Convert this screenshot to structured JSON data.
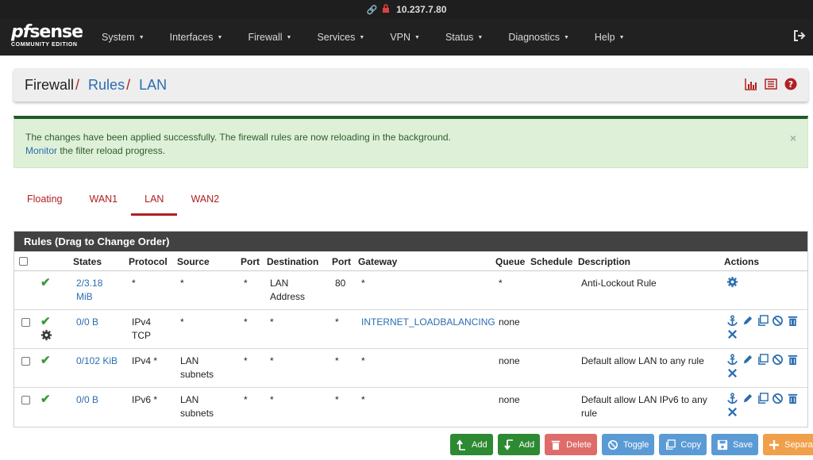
{
  "browser": {
    "url": "10.237.7.80"
  },
  "brand": {
    "name_italic": "pf",
    "name_rest": "sense",
    "edition": "COMMUNITY EDITION"
  },
  "nav": {
    "items": [
      "System",
      "Interfaces",
      "Firewall",
      "Services",
      "VPN",
      "Status",
      "Diagnostics",
      "Help"
    ]
  },
  "breadcrumb": {
    "root": "Firewall",
    "sep": "/",
    "rules": "Rules",
    "current": "LAN"
  },
  "alert": {
    "line1": "The changes have been applied successfully. The firewall rules are now reloading in the background.",
    "link": "Monitor",
    "line2_rest": " the filter reload progress.",
    "close": "×"
  },
  "tabs": [
    "Floating",
    "WAN1",
    "LAN",
    "WAN2"
  ],
  "table": {
    "title": "Rules (Drag to Change Order)",
    "headers": {
      "states": "States",
      "protocol": "Protocol",
      "source": "Source",
      "port": "Port",
      "destination": "Destination",
      "dport": "Port",
      "gateway": "Gateway",
      "queue": "Queue",
      "schedule": "Schedule",
      "description": "Description",
      "actions": "Actions"
    },
    "rows": [
      {
        "states1": "2/3.18",
        "states2": "MiB",
        "protocol1": "*",
        "protocol2": "",
        "source1": "*",
        "source2": "",
        "port": "*",
        "dest1": "LAN",
        "dest2": "Address",
        "dport": "80",
        "gateway": "*",
        "queue": "*",
        "description1": "Anti-Lockout Rule",
        "description2": ""
      },
      {
        "states1": "0/0 B",
        "states2": "",
        "protocol1": "IPv4",
        "protocol2": "TCP",
        "source1": "*",
        "source2": "",
        "port": "*",
        "dest1": "*",
        "dest2": "",
        "dport": "*",
        "gateway": "INTERNET_LOADBALANCING",
        "queue": "none",
        "description1": "",
        "description2": ""
      },
      {
        "states1": "0/102 KiB",
        "states2": "",
        "protocol1": "IPv4 *",
        "protocol2": "",
        "source1": "LAN",
        "source2": "subnets",
        "port": "*",
        "dest1": "*",
        "dest2": "",
        "dport": "*",
        "gateway": "*",
        "queue": "none",
        "description1": "Default allow LAN to any rule",
        "description2": ""
      },
      {
        "states1": "0/0 B",
        "states2": "",
        "protocol1": "IPv6 *",
        "protocol2": "",
        "source1": "LAN",
        "source2": "subnets",
        "port": "*",
        "dest1": "*",
        "dest2": "",
        "dport": "*",
        "gateway": "*",
        "queue": "none",
        "description1": "Default allow LAN IPv6 to any",
        "description2": "rule"
      }
    ]
  },
  "buttons": {
    "add_top": "Add",
    "add_bottom": "Add",
    "delete": "Delete",
    "toggle": "Toggle",
    "copy": "Copy",
    "save": "Save",
    "separator": "Separator"
  },
  "colors": {
    "accent_red": "#b02020",
    "link_blue": "#2a6db0",
    "nav_bg": "#212121",
    "success_bg": "#dff0d8"
  }
}
